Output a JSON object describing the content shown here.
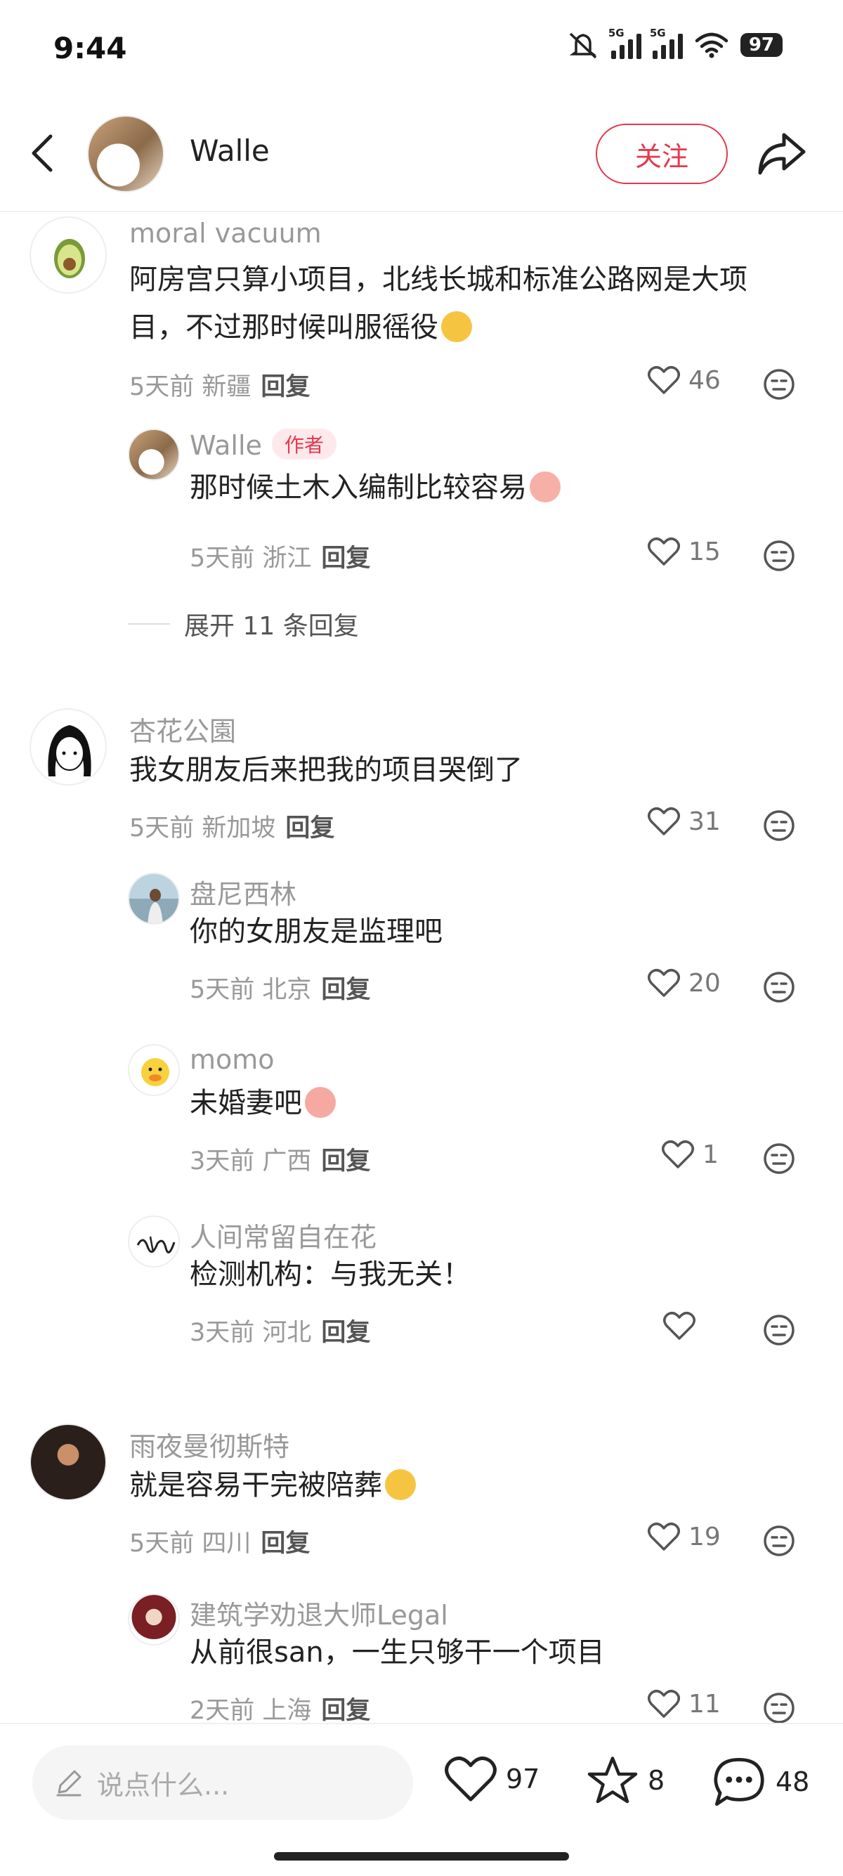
{
  "status_bar": {
    "time": "9:44",
    "network_1": "5G",
    "network_2": "5G",
    "battery": "97"
  },
  "header": {
    "author_name": "Walle",
    "follow_label": "关注"
  },
  "comments": [
    {
      "user": "moral vacuum",
      "text": "阿房宫只算小项目，北线长城和标准公路网是大项目，不过那时候叫服徭役",
      "time_loc": "5天前 新疆",
      "reply": "回复",
      "likes": "46"
    },
    {
      "user": "Walle",
      "badge": "作者",
      "text": "那时候土木入编制比较容易",
      "time_loc": "5天前 浙江",
      "reply": "回复",
      "likes": "15"
    },
    {
      "expand": "展开 11 条回复"
    },
    {
      "user": "杏花公園",
      "text": "我女朋友后来把我的项目哭倒了",
      "time_loc": "5天前 新加坡",
      "reply": "回复",
      "likes": "31"
    },
    {
      "user": "盘尼西林",
      "text": "你的女朋友是监理吧",
      "time_loc": "5天前 北京",
      "reply": "回复",
      "likes": "20"
    },
    {
      "user": "momo",
      "text": "未婚妻吧",
      "time_loc": "3天前 广西",
      "reply": "回复",
      "likes": "1"
    },
    {
      "user": "人间常留自在花",
      "text": "检测机构：与我无关！",
      "time_loc": "3天前 河北",
      "reply": "回复",
      "likes": ""
    },
    {
      "user": "雨夜曼彻斯特",
      "text": "就是容易干完被陪葬",
      "time_loc": "5天前 四川",
      "reply": "回复",
      "likes": "19"
    },
    {
      "user": "建筑学劝退大师Legal",
      "text": "从前很san，一生只够干一个项目",
      "time_loc": "2天前 上海",
      "reply": "回复",
      "likes": "11"
    }
  ],
  "bottom_bar": {
    "input_placeholder": "说点什么...",
    "likes": "97",
    "favorites": "8",
    "comments": "48"
  },
  "colors": {
    "accent": "#e4394d",
    "muted": "#999999"
  }
}
